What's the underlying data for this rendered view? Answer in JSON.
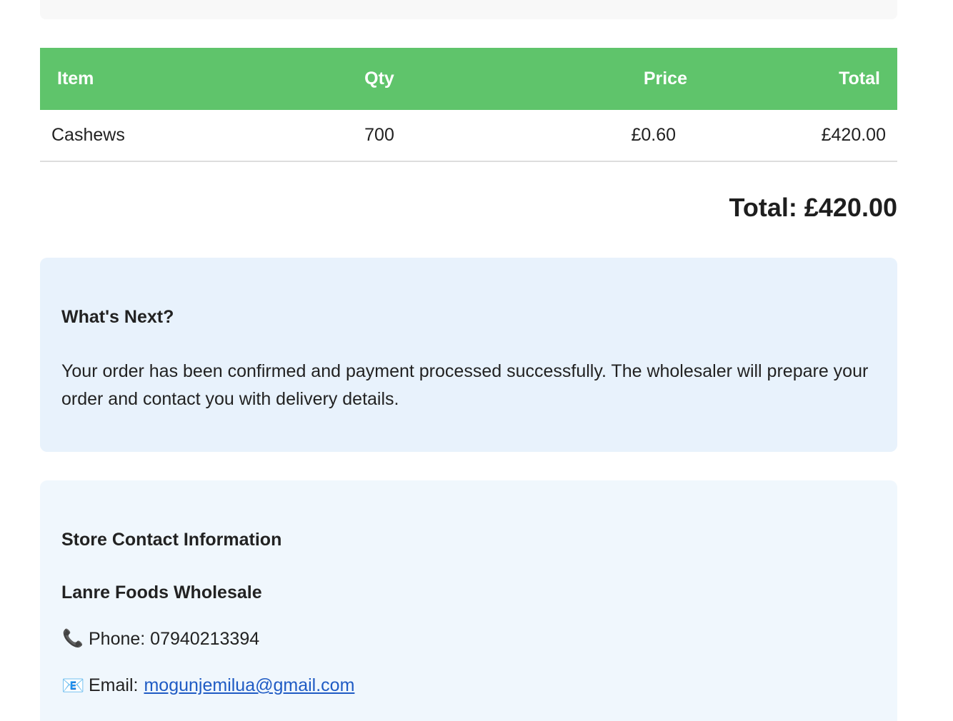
{
  "table": {
    "headers": {
      "item": "Item",
      "qty": "Qty",
      "price": "Price",
      "total": "Total"
    },
    "rows": [
      {
        "item": "Cashews",
        "qty": "700",
        "price": "£0.60",
        "total": "£420.00"
      }
    ]
  },
  "summary": {
    "grand_total": "Total: £420.00"
  },
  "next_steps": {
    "title": "What's Next?",
    "body": "Your order has been confirmed and payment processed successfully. The wholesaler will prepare your order and contact you with delivery details."
  },
  "contact": {
    "title": "Store Contact Information",
    "store_name": "Lanre Foods Wholesale",
    "phone_label": "Phone: 07940213394",
    "phone_icon": "telephone-icon",
    "email_label": "Email:",
    "email_icon": "envelope-icon",
    "email": "mogunjemilua@gmail.com"
  },
  "colors": {
    "header_green": "#5fc46b",
    "next_box_bg": "#e8f2fc",
    "contact_box_bg": "#f0f7fd",
    "link": "#1f5bc4"
  }
}
